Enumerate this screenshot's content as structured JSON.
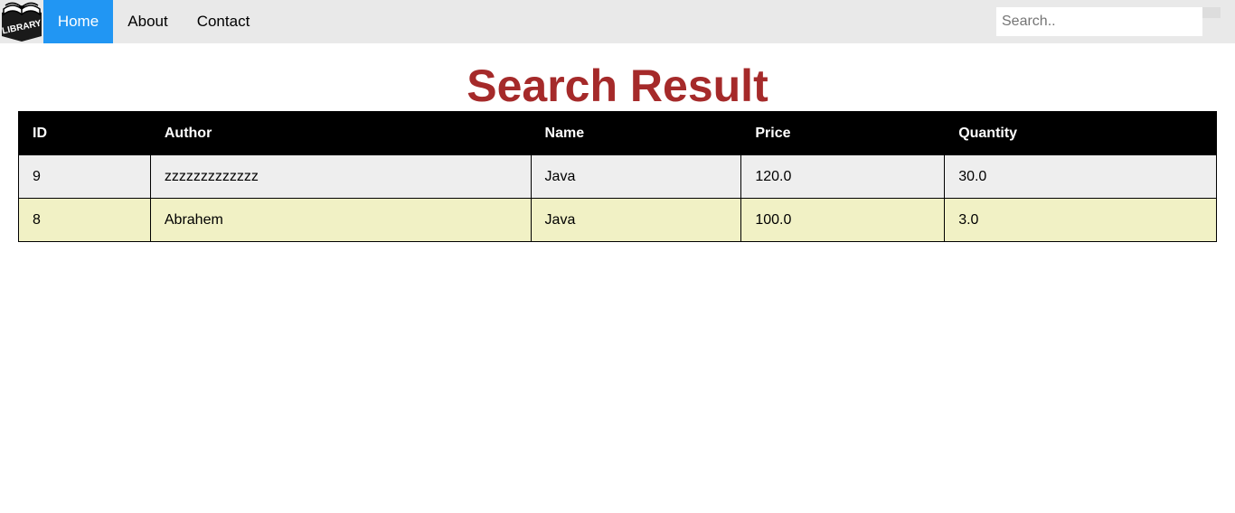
{
  "nav": {
    "logo_text": "LIBRARY",
    "links": [
      {
        "label": "Home",
        "active": true
      },
      {
        "label": "About",
        "active": false
      },
      {
        "label": "Contact",
        "active": false
      }
    ],
    "search_placeholder": "Search..",
    "search_value": ""
  },
  "main": {
    "title": "Search Result",
    "table": {
      "headers": [
        "ID",
        "Author",
        "Name",
        "Price",
        "Quantity"
      ],
      "rows": [
        [
          "9",
          "zzzzzzzzzzzzz",
          "Java",
          "120.0",
          "30.0"
        ],
        [
          "8",
          "Abrahem",
          "Java",
          "100.0",
          "3.0"
        ]
      ]
    }
  },
  "colors": {
    "nav_background": "#e9e9e9",
    "nav_active": "#2196F3",
    "title": "#a52a2a",
    "table_header": "#000000",
    "row_odd": "#eeeeee",
    "row_even": "#f1f1c5"
  },
  "icons": {
    "logo": "library-book-logo-icon"
  }
}
